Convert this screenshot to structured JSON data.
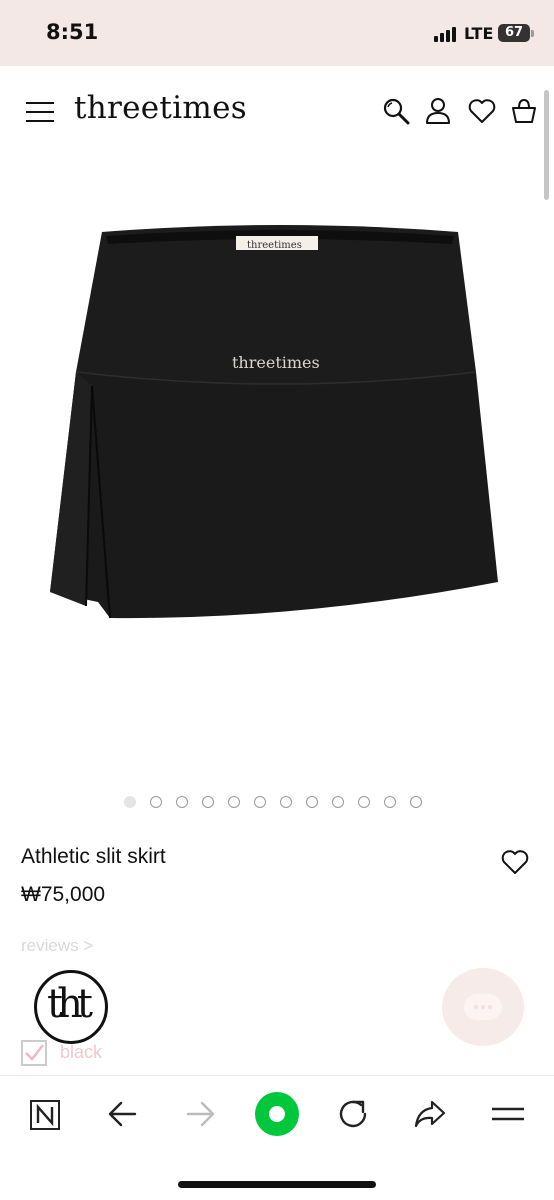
{
  "status_bar": {
    "time": "8:51",
    "network": "LTE",
    "battery": "67"
  },
  "header": {
    "brand": "threetimes",
    "icons": [
      "menu-icon",
      "search-icon",
      "user-icon",
      "heart-icon",
      "cart-icon"
    ]
  },
  "product": {
    "image_logo_text": "threetimes",
    "tag_text": "threetimes",
    "title": "Athletic slit skirt",
    "price": "₩75,000",
    "reviews_link": "reviews >",
    "carousel": {
      "total_images": 12,
      "current": 1
    },
    "color_option": {
      "label": "black",
      "checked": true
    }
  },
  "overlay": {
    "logo_text": "tht"
  },
  "browser_toolbar": {
    "buttons": [
      "naver-n-icon",
      "back-arrow-icon",
      "forward-arrow-icon",
      "green-dot-icon",
      "reload-icon",
      "share-icon",
      "menu-lines-icon"
    ]
  },
  "colors": {
    "status_bar_bg": "#f4e8e6",
    "accent_green": "#00c73c",
    "skirt": "#1a1a1a",
    "chat_button": "#f7ebe9"
  }
}
